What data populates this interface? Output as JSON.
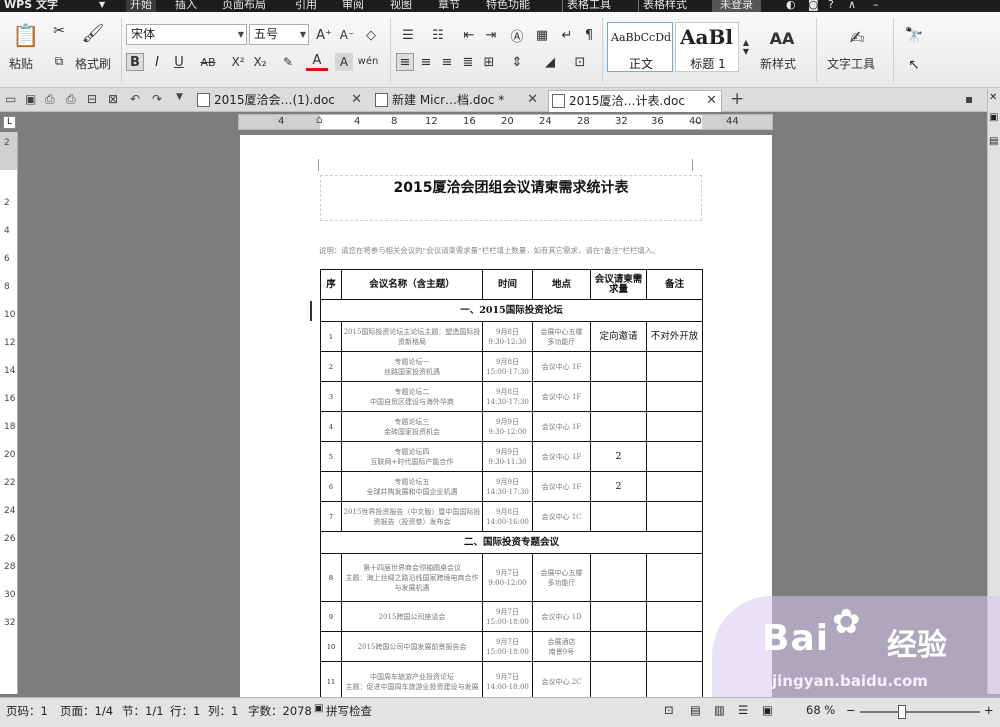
{
  "menu": {
    "app": "WPS 文字",
    "items": [
      "开始",
      "插入",
      "页面布局",
      "引用",
      "审阅",
      "视图",
      "章节",
      "特色功能",
      "表格工具",
      "表格样式"
    ],
    "login": "未登录"
  },
  "ribbon": {
    "paste": "粘贴",
    "format_painter": "格式刷",
    "font_name": "宋体",
    "font_size": "五号",
    "style_normal_preview": "AaBbCcDd",
    "style_normal": "正文",
    "style_heading_preview": "AaBl",
    "style_heading": "标题 1",
    "new_style": "新样式",
    "text_tools": "文字工具"
  },
  "tabs": [
    {
      "label": "2015厦洽会…(1).doc"
    },
    {
      "label": "新建 Micr…档.doc *"
    },
    {
      "label": "2015厦洽…计表.doc"
    }
  ],
  "ruler": {
    "h": [
      "4",
      "4",
      "8",
      "12",
      "16",
      "20",
      "24",
      "28",
      "32",
      "36",
      "40",
      "44"
    ],
    "v": [
      "2",
      "2",
      "4",
      "6",
      "8",
      "10",
      "12",
      "14",
      "16",
      "18",
      "20",
      "22",
      "24",
      "26",
      "28",
      "30",
      "32"
    ]
  },
  "document": {
    "title": "2015厦洽会团组会议请柬需求统计表",
    "note": "说明：请您在将参与相关会议的“会议请柬需求量”栏栏填上数量，如有其它需求，请在“备注”栏栏填入。",
    "headers": [
      "序",
      "会议名称（含主题）",
      "时间",
      "地点",
      "会议请柬需求量",
      "备注"
    ],
    "section1": "一、2015国际投资论坛",
    "section2": "二、国际投资专题会议",
    "rows1": [
      {
        "seq": "1",
        "name": "2015国际投资论坛主论坛主题：塑造国际投资新格局",
        "time": "9月8日\n9:30-12:30",
        "place": "会展中心五楼\n多功能厅",
        "qty": "定向邀请",
        "remark": "不对外开放"
      },
      {
        "seq": "2",
        "name": "专题论坛一\n丝路国家投资机遇",
        "time": "9月8日\n15:00-17:30",
        "place": "会议中心 1F",
        "qty": "",
        "remark": ""
      },
      {
        "seq": "3",
        "name": "专题论坛二\n中国自贸区建设与海外华商",
        "time": "9月8日\n14:30-17:30",
        "place": "会议中心 1F",
        "qty": "",
        "remark": ""
      },
      {
        "seq": "4",
        "name": "专题论坛三\n金砖国家投资机会",
        "time": "9月9日\n9:30-12:00",
        "place": "会议中心 1F",
        "qty": "",
        "remark": ""
      },
      {
        "seq": "5",
        "name": "专题论坛四\n互联网+时代国际产能合作",
        "time": "9月9日\n9:30-11:30",
        "place": "会议中心 1F",
        "qty": "2",
        "remark": ""
      },
      {
        "seq": "6",
        "name": "专题论坛五\n全球并购发展和中国企业机遇",
        "time": "9月9日\n14:30-17:30",
        "place": "会议中心 1F",
        "qty": "2",
        "remark": ""
      },
      {
        "seq": "7",
        "name": "2015世界投资报告（中文版）暨中国国际投资报告（投资卷）发布会",
        "time": "9月8日\n14:00-16:00",
        "place": "会议中心 1C",
        "qty": "",
        "remark": ""
      }
    ],
    "rows2": [
      {
        "seq": "8",
        "name": "第十四届世界商会领袖圆桌会议\n主题：海上丝绸之路沿线国家跨境电商合作与发展机遇",
        "time": "9月7日\n9:00-12:00",
        "place": "会展中心五楼\n多功能厅",
        "qty": "",
        "remark": ""
      },
      {
        "seq": "9",
        "name": "2015跨国公司座谈会",
        "time": "9月7日\n15:00-18:00",
        "place": "会议中心 1D",
        "qty": "",
        "remark": ""
      },
      {
        "seq": "10",
        "name": "2015跨国公司中国发展前景报告会",
        "time": "9月7日\n15:00-18:00",
        "place": "会展酒店\n南景9号",
        "qty": "",
        "remark": ""
      },
      {
        "seq": "11",
        "name": "中国周车旅游产业投资论坛\n主题：促进中国周车旅游业投资建设与发展",
        "time": "9月7日\n14:00-18:00",
        "place": "会议中心 2C",
        "qty": "",
        "remark": ""
      }
    ]
  },
  "status": {
    "page_no": "页码：1",
    "page": "页面：1/4",
    "section": "节：1/1",
    "row": "行：1",
    "col": "列：1",
    "words": "字数：2078",
    "spell": "拼写检查",
    "zoom": "68 %"
  },
  "watermark": {
    "brand": "Bai",
    "brand2": "经验",
    "url": "jingyan.baidu.com"
  }
}
